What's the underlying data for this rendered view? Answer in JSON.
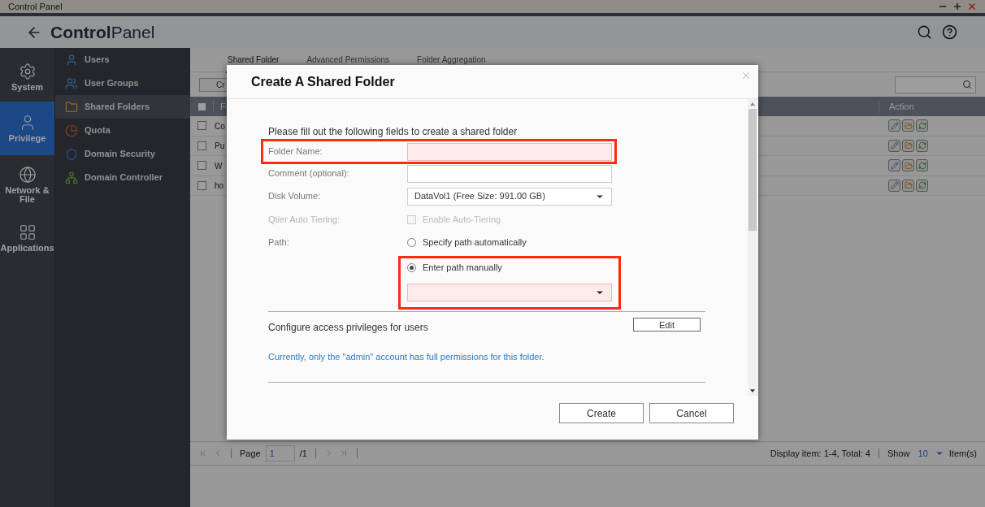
{
  "window": {
    "title": "Control Panel"
  },
  "app_bar": {
    "title_bold": "Control",
    "title_light": "Panel"
  },
  "nav": [
    {
      "label": "System",
      "selected": false
    },
    {
      "label": "Privilege",
      "selected": true
    },
    {
      "label": "Network & File",
      "selected": false
    },
    {
      "label": "Applications",
      "selected": false
    }
  ],
  "submenu": [
    {
      "label": "Users",
      "selected": false
    },
    {
      "label": "User Groups",
      "selected": false
    },
    {
      "label": "Shared Folders",
      "selected": true
    },
    {
      "label": "Quota",
      "selected": false
    },
    {
      "label": "Domain Security",
      "selected": false
    },
    {
      "label": "Domain Controller",
      "selected": false
    }
  ],
  "tabs": [
    {
      "label": "Shared Folder",
      "selected": true
    },
    {
      "label": "Advanced Permissions",
      "selected": false
    },
    {
      "label": "Folder Aggregation",
      "selected": false
    }
  ],
  "toolbar": {
    "button": "Cr"
  },
  "table": {
    "columns": [
      "F",
      "Action"
    ],
    "all_checked": false,
    "rows": [
      {
        "cell": "Co",
        "checked": false
      },
      {
        "cell": "Pu",
        "checked": false
      },
      {
        "cell": "W",
        "checked": false
      },
      {
        "cell": "ho",
        "checked": false
      }
    ]
  },
  "pager": {
    "page_label": "Page",
    "page": "1",
    "of": "/1",
    "display": "Display item: 1-4, Total: 4",
    "show": "Show",
    "per_page": "10",
    "items": "Item(s)"
  },
  "dialog": {
    "title": "Create A Shared Folder",
    "intro": "Please fill out the following fields to create a shared folder",
    "fields": [
      {
        "kind": "text",
        "label": "Folder Name:",
        "invalid": true,
        "highlighted": true
      },
      {
        "kind": "text",
        "label": "Comment (optional):",
        "invalid": false,
        "highlighted": false
      },
      {
        "kind": "select",
        "label": "Disk Volume:",
        "value": "DataVol1 (Free Size: 991.00 GB)"
      },
      {
        "kind": "checkbox",
        "label": "Qtier Auto Tiering:",
        "option": "Enable Auto-Tiering",
        "checked": false,
        "disabled": true
      },
      {
        "kind": "radio",
        "label": "Path:",
        "options": [
          {
            "label": "Specify path automatically",
            "selected": false
          },
          {
            "label": "Enter path manually",
            "selected": true
          }
        ],
        "path_invalid": true,
        "highlighted": true
      }
    ],
    "privileges": {
      "heading": "Configure access privileges for users",
      "button": "Edit",
      "note": "Currently, only the \"admin\" account has full permissions for this folder."
    },
    "buttons": [
      "Create",
      "Cancel"
    ]
  }
}
